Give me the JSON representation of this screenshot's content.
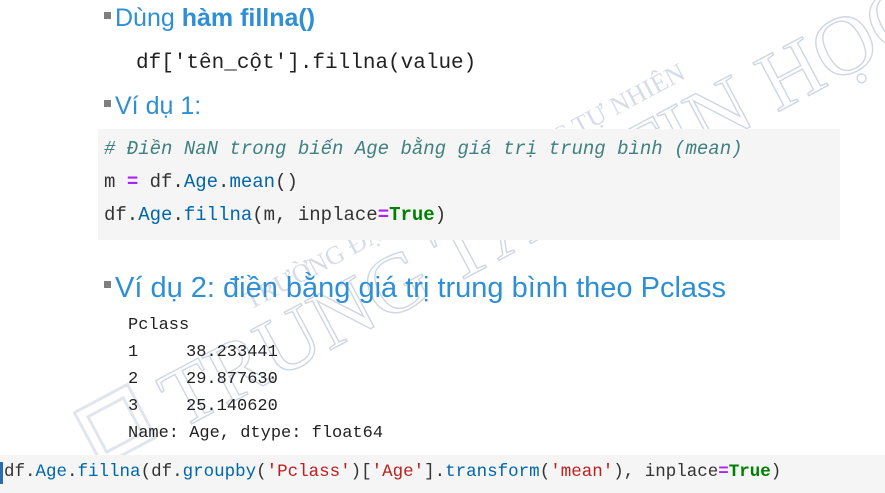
{
  "slide": {
    "bullet1": {
      "prefix": "Dùng ",
      "bold": "hàm fillna()"
    },
    "syntax": "df['tên_cột'].fillna(value)",
    "bullet2": "Ví dụ 1:",
    "example1": {
      "comment": "# Điền NaN trong biến Age bằng giá trị trung bình (mean)",
      "line2": {
        "var": "m ",
        "op": "=",
        "df": " df.",
        "attr": "Age",
        "dot": ".",
        "method": "mean",
        "tail": "()"
      },
      "line3": {
        "df": "df.",
        "attr": "Age",
        "dot": ".",
        "method": "fillna",
        "args": "(m, inplace",
        "op": "=",
        "kw": "True",
        "tail": ")"
      }
    },
    "bullet3": "Ví dụ 2: điền bằng giá trị trung bình theo Pclass",
    "output": {
      "header": "Pclass",
      "rows": [
        {
          "index": "1",
          "value": "38.233441"
        },
        {
          "index": "2",
          "value": "29.877630"
        },
        {
          "index": "3",
          "value": "25.140620"
        }
      ],
      "footer": "Name: Age, dtype: float64"
    },
    "example2": {
      "df1": "df.",
      "attr1": "Age",
      "dot1": ".",
      "m1": "fillna",
      "p1": "(df.",
      "m2": "groupby",
      "p2": "(",
      "s1": "'Pclass'",
      "p3": ")[",
      "s2": "'Age'",
      "p4": "].",
      "m3": "transform",
      "p5": "(",
      "s3": "'mean'",
      "p6": "), inplace",
      "op": "=",
      "kw": "True",
      "tail": ")"
    }
  },
  "watermark": {
    "line_top": "TRƯỜNG ĐẠI HỌC KHOA HỌC TỰ NHIÊN",
    "line_main": "TRUNG TÂM TIN HỌC",
    "color": "#b8c4d8"
  }
}
